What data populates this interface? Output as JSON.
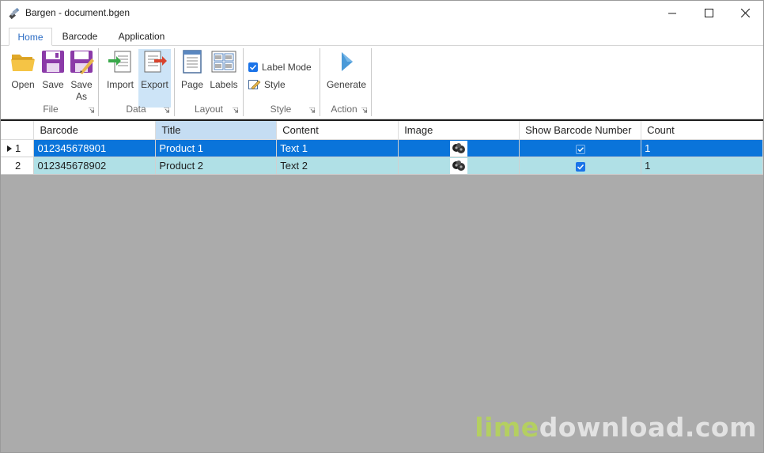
{
  "window": {
    "title": "Bargen - document.bgen"
  },
  "tabs": [
    {
      "label": "Home",
      "active": true
    },
    {
      "label": "Barcode",
      "active": false
    },
    {
      "label": "Application",
      "active": false
    }
  ],
  "ribbon": {
    "file": {
      "label": "File",
      "open": "Open",
      "save": "Save",
      "save_as_line1": "Save",
      "save_as_line2": "As"
    },
    "data": {
      "label": "Data",
      "import": "Import",
      "export": "Export"
    },
    "layout": {
      "label": "Layout",
      "page": "Page",
      "labels": "Labels"
    },
    "style": {
      "label": "Style",
      "label_mode": "Label Mode",
      "label_mode_checked": true,
      "style": "Style"
    },
    "action": {
      "label": "Action",
      "generate": "Generate"
    }
  },
  "grid": {
    "columns": [
      "Barcode",
      "Title",
      "Content",
      "Image",
      "Show Barcode Number",
      "Count"
    ],
    "selected_column": "Title",
    "rows": [
      {
        "index": "1",
        "barcode": "012345678901",
        "title": "Product 1",
        "content": "Text 1",
        "show_number": true,
        "count": "1",
        "selected": true
      },
      {
        "index": "2",
        "barcode": "012345678902",
        "title": "Product 2",
        "content": "Text 2",
        "show_number": true,
        "count": "1",
        "selected": false
      }
    ]
  },
  "watermark": {
    "part1": "lime",
    "part2": "download.com"
  },
  "colors": {
    "selection": "#0a74da",
    "alt_row": "#b0e0e6",
    "accent": "#2b6cc4",
    "empty_area": "#ababab"
  }
}
